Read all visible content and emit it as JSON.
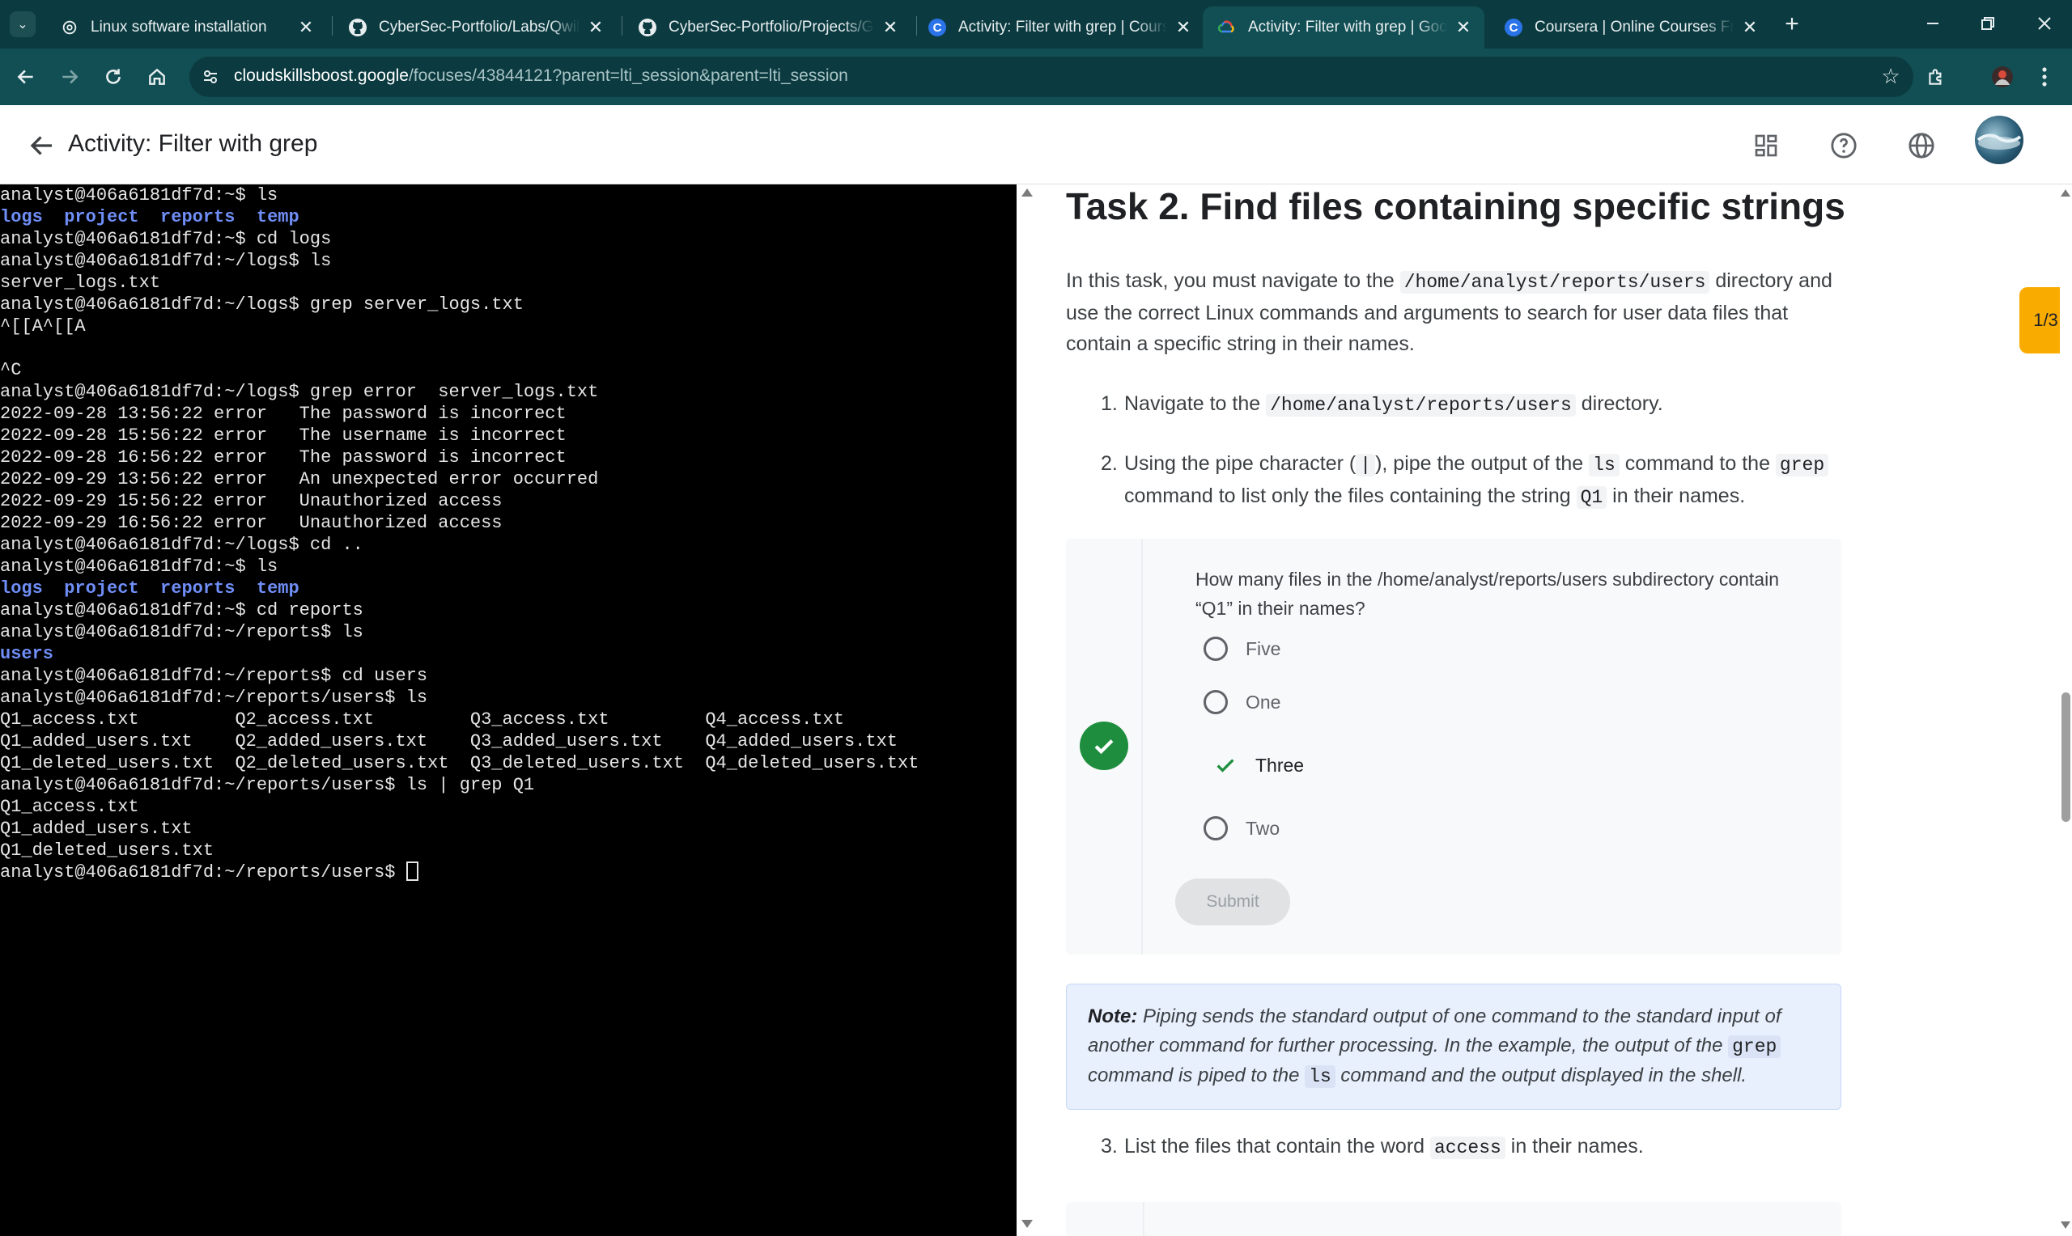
{
  "browser": {
    "tabs": [
      {
        "title": "Linux software installation",
        "icon": "openai-icon",
        "active": false
      },
      {
        "title": "CyberSec-Portfolio/Labs/Qwikla",
        "icon": "github-icon",
        "active": false
      },
      {
        "title": "CyberSec-Portfolio/Projects/Go",
        "icon": "github-icon",
        "active": false
      },
      {
        "title": "Activity: Filter with grep | Cours",
        "icon": "coursera-icon",
        "active": false
      },
      {
        "title": "Activity: Filter with grep | Googl",
        "icon": "google-cloud-icon",
        "active": true
      },
      {
        "title": "Coursera | Online Courses From",
        "icon": "coursera-icon",
        "active": false
      }
    ],
    "url_host": "cloudskillsboost.google",
    "url_path": "/focuses/43844121?parent=lti_session&parent=lti_session",
    "accent": "#114f54"
  },
  "header": {
    "title": "Activity: Filter with grep"
  },
  "terminal": {
    "prompt_user": "analyst@406a6181df7d",
    "lines": [
      {
        "segments": [
          {
            "t": "analyst@406a6181df7d:~$ ls"
          }
        ]
      },
      {
        "segments": [
          {
            "t": "logs",
            "dir": true
          },
          {
            "t": "  "
          },
          {
            "t": "project",
            "dir": true
          },
          {
            "t": "  "
          },
          {
            "t": "reports",
            "dir": true
          },
          {
            "t": "  "
          },
          {
            "t": "temp",
            "dir": true
          }
        ]
      },
      {
        "segments": [
          {
            "t": "analyst@406a6181df7d:~$ cd logs"
          }
        ]
      },
      {
        "segments": [
          {
            "t": "analyst@406a6181df7d:~/logs$ ls"
          }
        ]
      },
      {
        "segments": [
          {
            "t": "server_logs.txt"
          }
        ]
      },
      {
        "segments": [
          {
            "t": "analyst@406a6181df7d:~/logs$ grep server_logs.txt"
          }
        ]
      },
      {
        "segments": [
          {
            "t": "^[[A^[[A"
          }
        ]
      },
      {
        "segments": [
          {
            "t": ""
          }
        ]
      },
      {
        "segments": [
          {
            "t": "^C"
          }
        ]
      },
      {
        "segments": [
          {
            "t": "analyst@406a6181df7d:~/logs$ grep error  server_logs.txt"
          }
        ]
      },
      {
        "segments": [
          {
            "t": "2022-09-28 13:56:22 error   The password is incorrect"
          }
        ]
      },
      {
        "segments": [
          {
            "t": "2022-09-28 15:56:22 error   The username is incorrect"
          }
        ]
      },
      {
        "segments": [
          {
            "t": "2022-09-28 16:56:22 error   The password is incorrect"
          }
        ]
      },
      {
        "segments": [
          {
            "t": "2022-09-29 13:56:22 error   An unexpected error occurred"
          }
        ]
      },
      {
        "segments": [
          {
            "t": "2022-09-29 15:56:22 error   Unauthorized access"
          }
        ]
      },
      {
        "segments": [
          {
            "t": "2022-09-29 16:56:22 error   Unauthorized access"
          }
        ]
      },
      {
        "segments": [
          {
            "t": "analyst@406a6181df7d:~/logs$ cd .."
          }
        ]
      },
      {
        "segments": [
          {
            "t": "analyst@406a6181df7d:~$ ls"
          }
        ]
      },
      {
        "segments": [
          {
            "t": "logs",
            "dir": true
          },
          {
            "t": "  "
          },
          {
            "t": "project",
            "dir": true
          },
          {
            "t": "  "
          },
          {
            "t": "reports",
            "dir": true
          },
          {
            "t": "  "
          },
          {
            "t": "temp",
            "dir": true
          }
        ]
      },
      {
        "segments": [
          {
            "t": "analyst@406a6181df7d:~$ cd reports"
          }
        ]
      },
      {
        "segments": [
          {
            "t": "analyst@406a6181df7d:~/reports$ ls"
          }
        ]
      },
      {
        "segments": [
          {
            "t": "users",
            "dir": true
          }
        ]
      },
      {
        "segments": [
          {
            "t": "analyst@406a6181df7d:~/reports$ cd users"
          }
        ]
      },
      {
        "segments": [
          {
            "t": "analyst@406a6181df7d:~/reports/users$ ls"
          }
        ]
      },
      {
        "segments": [
          {
            "t": "Q1_access.txt         Q2_access.txt         Q3_access.txt         Q4_access.txt"
          }
        ]
      },
      {
        "segments": [
          {
            "t": "Q1_added_users.txt    Q2_added_users.txt    Q3_added_users.txt    Q4_added_users.txt"
          }
        ]
      },
      {
        "segments": [
          {
            "t": "Q1_deleted_users.txt  Q2_deleted_users.txt  Q3_deleted_users.txt  Q4_deleted_users.txt"
          }
        ]
      },
      {
        "segments": [
          {
            "t": "analyst@406a6181df7d:~/reports/users$ ls | grep Q1"
          }
        ]
      },
      {
        "segments": [
          {
            "t": "Q1_access.txt"
          }
        ]
      },
      {
        "segments": [
          {
            "t": "Q1_added_users.txt"
          }
        ]
      },
      {
        "segments": [
          {
            "t": "Q1_deleted_users.txt"
          }
        ]
      },
      {
        "segments": [
          {
            "t": "analyst@406a6181df7d:~/reports/users$ "
          }
        ],
        "cursor": true
      }
    ],
    "dir_color": "#6f8ef7"
  },
  "instructions": {
    "task_title": "Task 2. Find files containing specific strings",
    "intro": {
      "a": "In this task, you must navigate to the ",
      "code": "/home/analyst/reports/users",
      "b": " directory and",
      "line2": "use the correct Linux commands and arguments to search for user data files that",
      "line3": "contain a specific string in their names."
    },
    "step1": {
      "num": "1.",
      "a": "Navigate to the ",
      "code": "/home/analyst/reports/users",
      "b": " directory."
    },
    "step2": {
      "num": "2.",
      "a": "Using the pipe character (",
      "code_pipe": "|",
      "b": "), pipe the output of the ",
      "code_ls": "ls",
      "c": " command to the ",
      "code_grep": "grep",
      "d": "command to list only the files containing the string ",
      "code_q1": "Q1",
      "e": " in their names."
    },
    "quiz": {
      "question": "How many files in the /home/analyst/reports/users subdirectory contain “Q1” in their names?",
      "options": [
        "Five",
        "One",
        "Three",
        "Two"
      ],
      "correct_index": 2,
      "submit_label": "Submit",
      "success_color": "#1e8e3e"
    },
    "note": {
      "label": "Note:",
      "a": " Piping sends the standard output of one command to the standard input of another command for further processing. In the example, the output of the ",
      "code_grep": "grep",
      "b": " command is piped to the ",
      "code_ls": "ls",
      "c": " command and the output displayed in the shell."
    },
    "step3": {
      "num": "3.",
      "a": "List the files that contain the word ",
      "code": "access",
      "b": " in their names."
    },
    "progress": "1/3",
    "progress_color": "#f9ab00"
  }
}
